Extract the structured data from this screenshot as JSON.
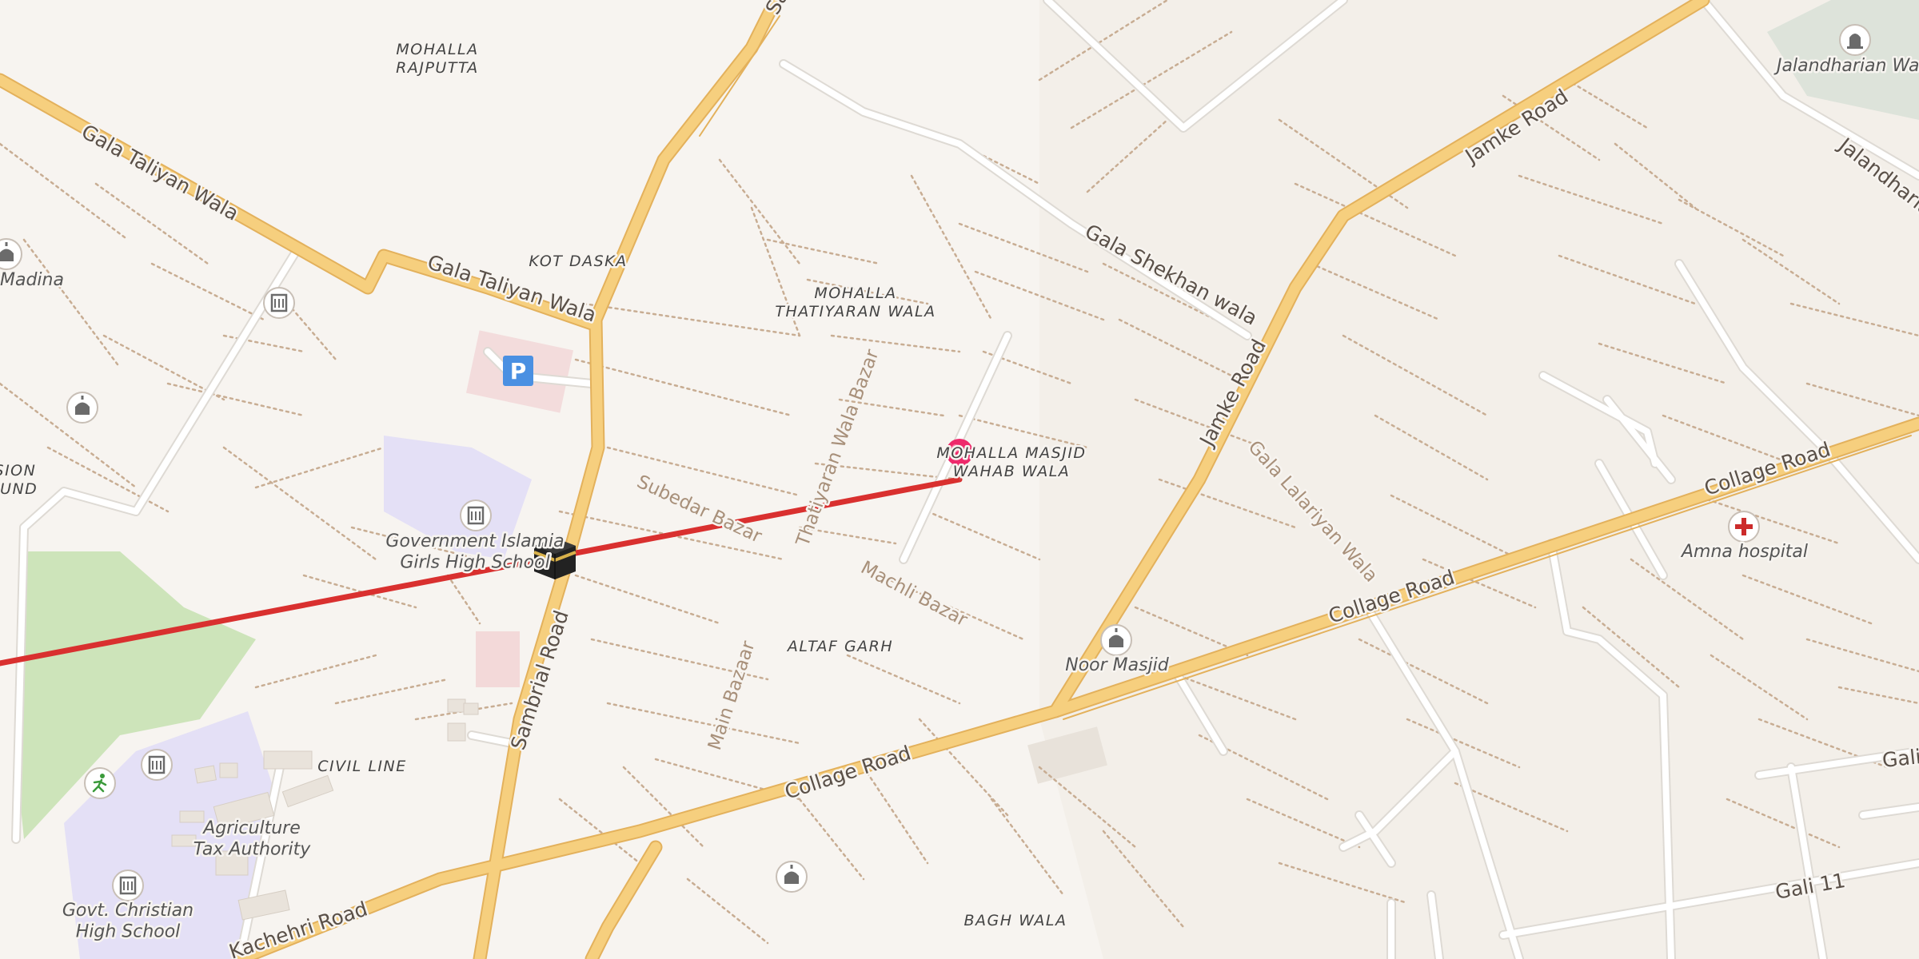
{
  "map": {
    "colors": {
      "background": "#f7f4f0",
      "primary_road": "#f6cf7e",
      "primary_road_casing": "#e3b15c",
      "minor_road": "#ffffff",
      "footpath": "#c8ad93",
      "route": "#d9302f",
      "pin": "#ee2a6b",
      "park": "#c8e2b4",
      "school_area": "#e4e0f6",
      "hospital": "#cc2b2b"
    },
    "areas": [
      "MOHALLA RAJPUTTA",
      "KOT DASKA",
      "MOHALLA THATIYARAN WALA",
      "MOHALLA MASJID WAHAB WALA",
      "ALTAF GARH",
      "CIVIL LINE",
      "BAGH WALA",
      "MISSION GROUND"
    ],
    "roads": [
      "Gala Taliyan Wala",
      "Gala Taliyan Wala",
      "Sambrial Road",
      "Sambrial Road",
      "Jamke Road",
      "Jamke Road",
      "Gala Shekhan wala",
      "Collage Road",
      "Collage Road",
      "Collage Road",
      "Kachehri Road",
      "Jalandharian",
      "Gali 11",
      "Gali"
    ],
    "lanes": [
      "Subedar Bazar",
      "Thatiyaran Wala Bazar",
      "Machli Bazar",
      "Main Bazaar",
      "Gala Lalariyan Wala"
    ],
    "pois": [
      "Government Islamia Girls High School",
      "Agriculture Tax Authority",
      "Govt. Christian High School",
      "Noor Masjid",
      "Amna hospital",
      "Madina",
      "Jalandharian Wala"
    ],
    "icons": {
      "mosque": "mosque-icon",
      "school": "school-icon",
      "parking": "parking-icon",
      "kaaba": "kaaba-icon",
      "hospital": "hospital-cross-icon",
      "sport": "running-person-icon",
      "cemetery": "tombstone-icon",
      "pin": "map-pin-icon"
    },
    "route": {
      "label": "",
      "color": "#d9302f"
    },
    "parking_letter": "P"
  }
}
